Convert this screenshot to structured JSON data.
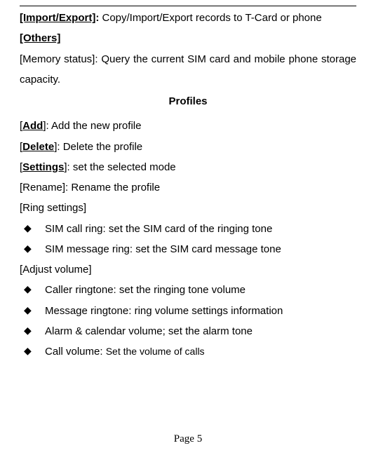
{
  "top": {
    "import_export_label": "[Import/Export]",
    "colon": ":",
    "import_export_desc": " Copy/Import/Export records to T-Card or phone",
    "others_label": "[Others]",
    "memory_status_label": "[Memory status]: ",
    "memory_status_desc": "Query the current SIM card and mobile phone storage capacity."
  },
  "profiles_heading": "Profiles",
  "profiles": {
    "add_bracket_open": "[",
    "add_label": "Add",
    "add_bracket_close": "]: ",
    "add_desc": "Add the new profile",
    "delete_bracket_open": "[",
    "delete_label": "Delete",
    "delete_bracket_close": "]: ",
    "delete_desc": "Delete the profile",
    "settings_bracket_open": "[",
    "settings_label": "Settings",
    "settings_bracket_close": "]: ",
    "settings_desc": "set the selected mode",
    "rename_full": "[Rename]: Rename the profile",
    "ring_settings_label": "[Ring settings]",
    "ring_items": {
      "sim_call": "SIM call ring: set the SIM card of the ringing tone",
      "sim_message": "SIM message ring: set the SIM card message tone"
    },
    "adjust_volume_label": "[Adjust volume]",
    "volume_items": {
      "caller": "Caller ringtone: set the ringing tone volume",
      "message": "Message ringtone: ring volume settings information",
      "alarm": "Alarm & calendar volume; set the alarm tone",
      "call_prefix": "Call volume: ",
      "call_suffix": "Set the volume of calls"
    }
  },
  "footer": "Page 5"
}
